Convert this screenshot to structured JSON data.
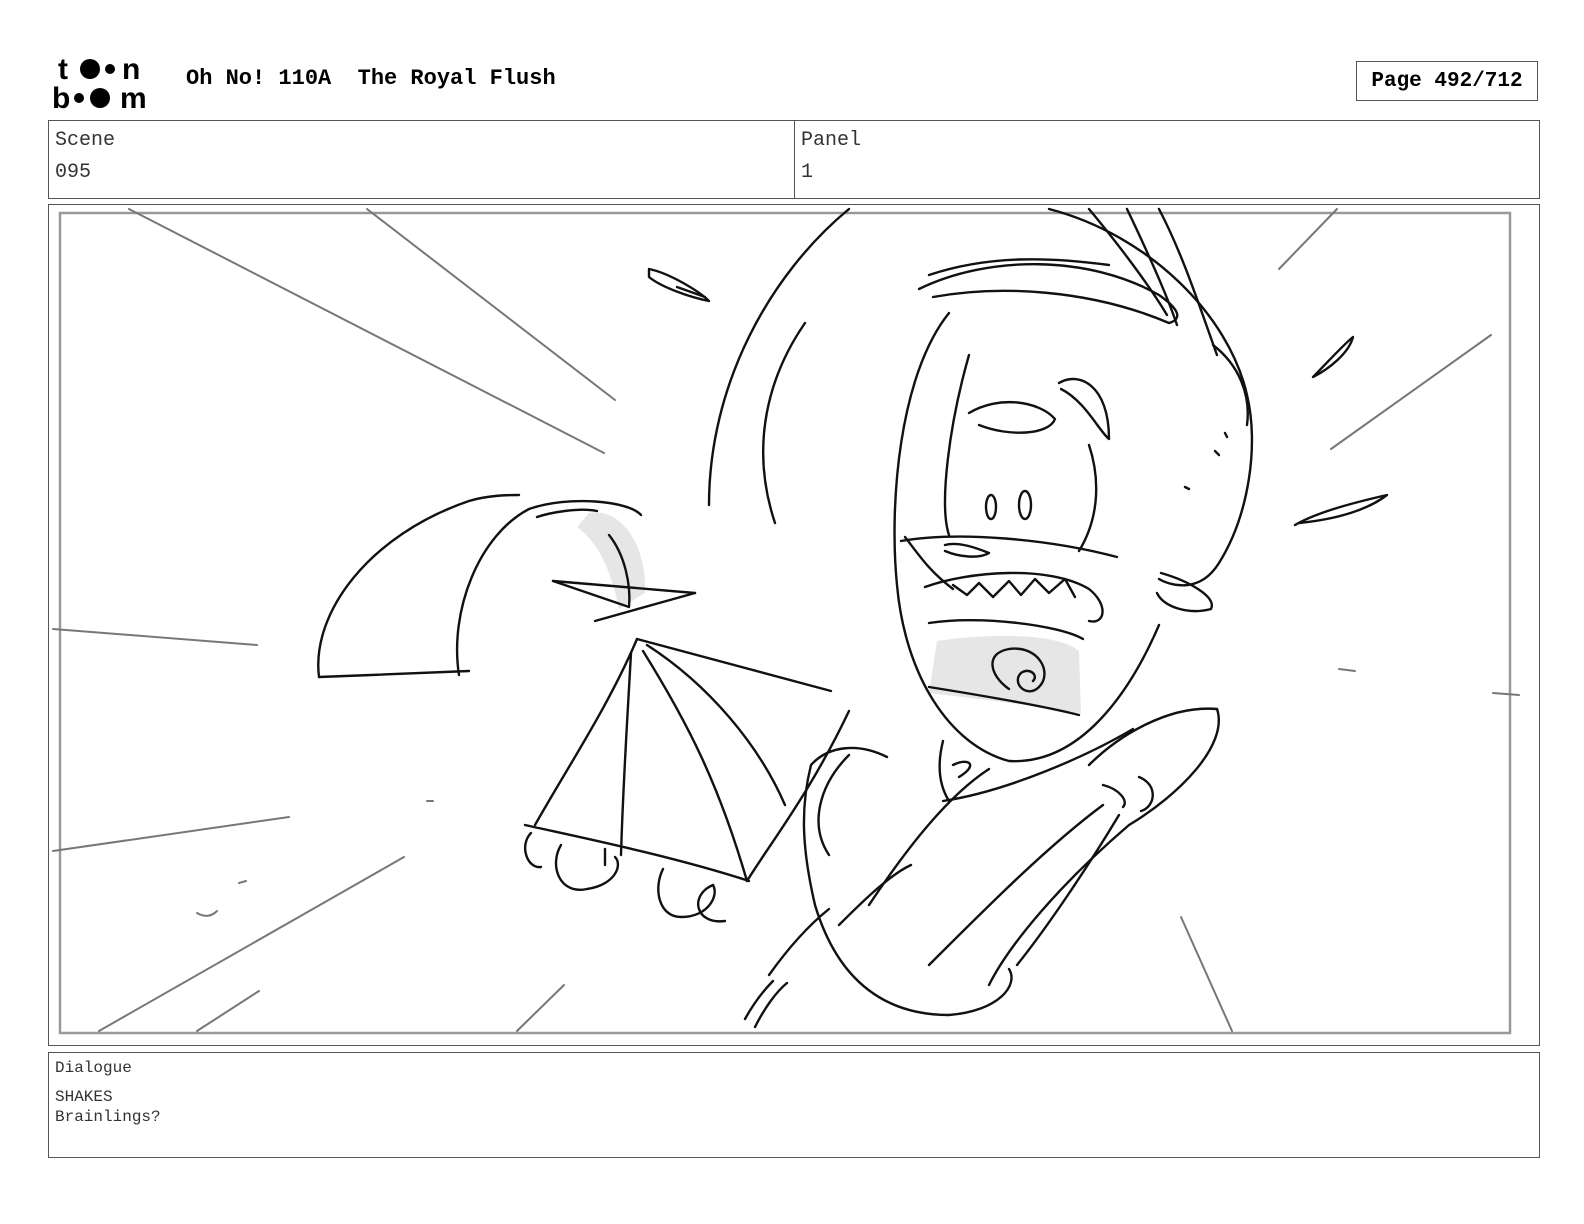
{
  "header": {
    "logo_text": "toonboom",
    "title": "Oh No! 110A  The Royal Flush",
    "page": "Page 492/712"
  },
  "info": {
    "scene_label": "Scene",
    "scene_value": "095",
    "panel_label": "Panel",
    "panel_value": "1"
  },
  "dialogue": {
    "label": "Dialogue",
    "lines": [
      "SHAKES",
      "Brainlings?"
    ]
  },
  "colors": {
    "border": "#555555",
    "sketch_line": "#111111",
    "speed_line": "#777777",
    "tone_fill": "#e6e6e6"
  }
}
